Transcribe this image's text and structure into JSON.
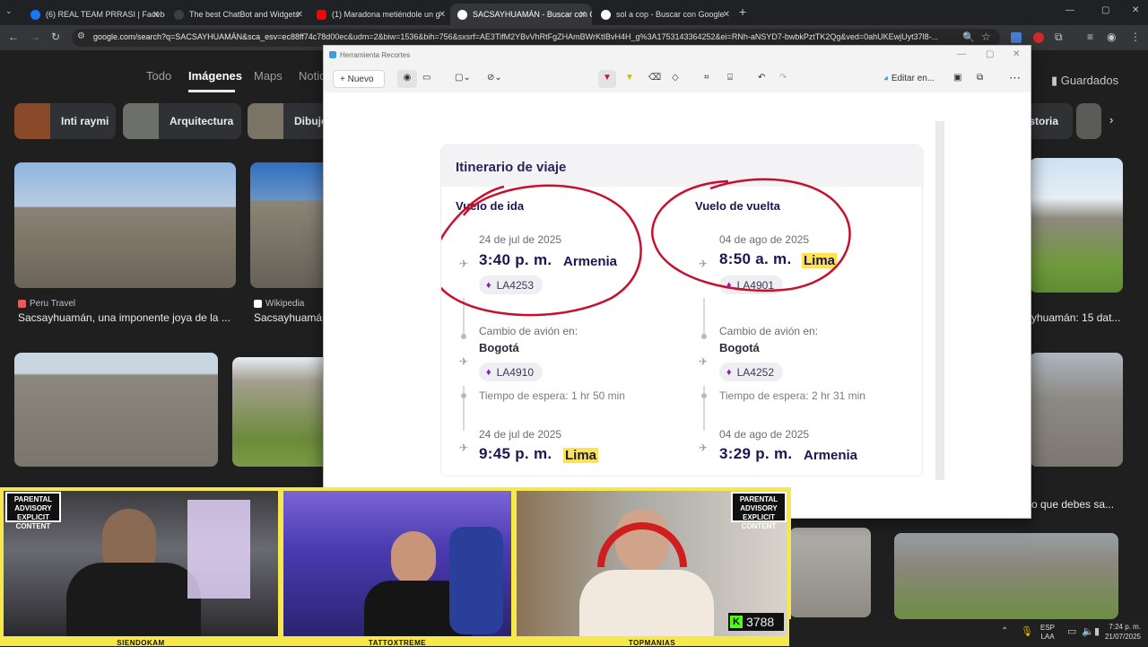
{
  "browser": {
    "tabs": [
      {
        "title": "(6) REAL TEAM PRRASI | Facebo",
        "icon": "facebook-icon",
        "color": "#1877f2"
      },
      {
        "title": "The best ChatBot and Widgets",
        "icon": "chatbot-icon",
        "color": "#5f6368"
      },
      {
        "title": "(1) Maradona metiéndole un g",
        "icon": "youtube-icon",
        "color": "#ff0000"
      },
      {
        "title": "SACSAYHUAMÁN - Buscar con G",
        "icon": "google-icon",
        "color": "#ffffff"
      },
      {
        "title": "sol a cop - Buscar con Google",
        "icon": "google-icon",
        "color": "#ffffff"
      }
    ],
    "new_tab": "+",
    "url": "google.com/search?q=SACSAYHUAMÁN&sca_esv=ec88ff74c78d00ec&udm=2&biw=1536&bih=756&sxsrf=AE3TifM2YBvVhRtFgZHAmBWrKtIBvH4H_g%3A1753143364252&ei=RNh-aNSYD7-bwbkPztTK2Qg&ved=0ahUKEwjUyt37l8-..."
  },
  "google": {
    "nav": [
      "Todo",
      "Imágenes",
      "Maps",
      "Notic"
    ],
    "saved": "Guardados",
    "chips": [
      {
        "label": "Inti raymi",
        "color": "#8a4a2a"
      },
      {
        "label": "Arquitectura",
        "color": "#6c6f6a"
      },
      {
        "label": "Dibujo",
        "color": "#7a7466"
      },
      {
        "label": "istoria",
        "color": "#5a5a56"
      }
    ],
    "results": [
      {
        "source": "Peru Travel",
        "caption": "Sacsayhuamán, una imponente joya de la ..."
      },
      {
        "source": "Wikipedia",
        "caption": "Sacsayhuamá"
      },
      {
        "source": "",
        "caption": "yhuamán: 15 dat..."
      },
      {
        "source": "",
        "caption": "o que debes sa..."
      }
    ]
  },
  "snip": {
    "app_title": "Herramienta Recortes",
    "new_label": "Nuevo",
    "edit_label": "Editar en...",
    "itinerary": {
      "title": "Itinerario de viaje",
      "outbound": {
        "heading": "Vuelo de ida",
        "dep_date": "24 de jul de 2025",
        "dep_time": "3:40 p. m.",
        "dep_city": "Armenia",
        "flight1": "LA4253",
        "change_label": "Cambio de avión en:",
        "change_city": "Bogotá",
        "flight2": "LA4910",
        "wait": "Tiempo de espera: 1 hr 50 min",
        "arr_date": "24 de jul de 2025",
        "arr_time": "9:45 p. m.",
        "arr_city": "Lima"
      },
      "return": {
        "heading": "Vuelo de vuelta",
        "dep_date": "04 de ago de 2025",
        "dep_time": "8:50 a. m.",
        "dep_city": "Lima",
        "flight1": "LA4901",
        "change_label": "Cambio de avión en:",
        "change_city": "Bogotá",
        "flight2": "LA4252",
        "wait": "Tiempo de espera: 2 hr 31 min",
        "arr_date": "04 de ago de 2025",
        "arr_time": "3:29 p. m.",
        "arr_city": "Armenia"
      }
    }
  },
  "stream": {
    "cams": [
      "SIENDOKAM",
      "TATTOXTREME",
      "TOPMANIAS"
    ],
    "advisory": "PARENTAL ADVISORY EXPLICIT CONTENT",
    "viewer_count": "3788"
  },
  "taskbar": {
    "lang": "ESP",
    "lang2": "LAA",
    "time": "7:24 p. m.",
    "date": "21/07/2025"
  }
}
